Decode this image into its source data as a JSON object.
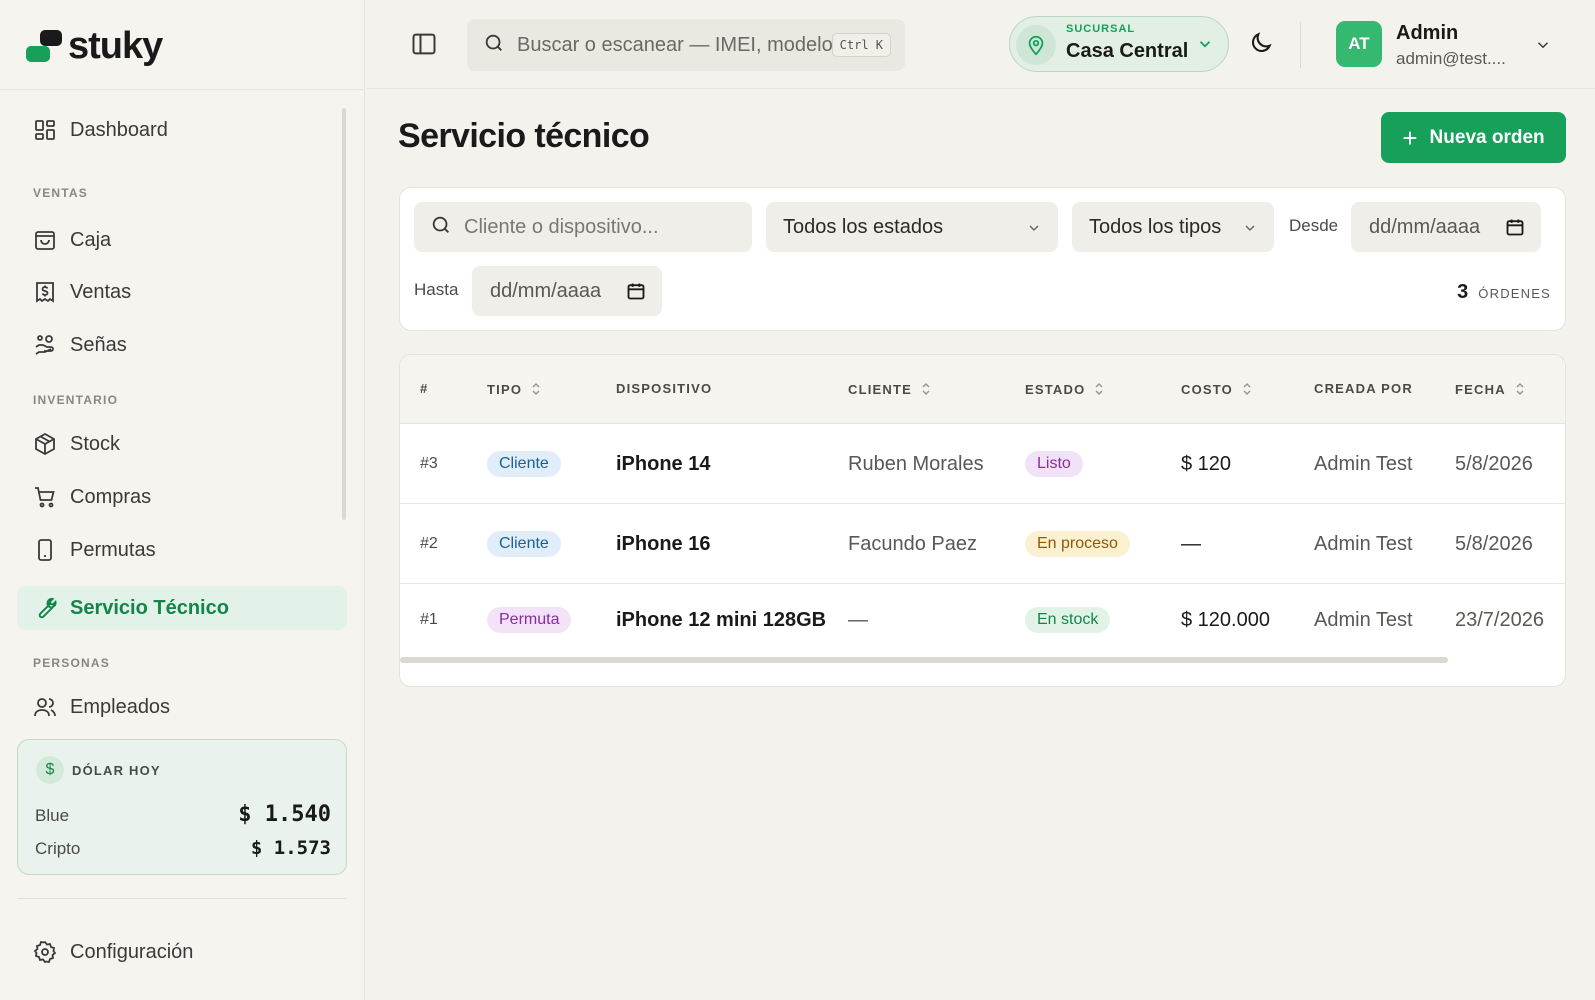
{
  "brand": {
    "name": "stuky"
  },
  "nav": {
    "dashboard": "Dashboard",
    "sections": {
      "ventas": "VENTAS",
      "inventario": "INVENTARIO",
      "personas": "PERSONAS"
    },
    "caja": "Caja",
    "ventas": "Ventas",
    "senas": "Señas",
    "stock": "Stock",
    "compras": "Compras",
    "permutas": "Permutas",
    "servicio": "Servicio Técnico",
    "empleados": "Empleados",
    "config": "Configuración"
  },
  "dolar": {
    "title": "DÓLAR HOY",
    "blue_label": "Blue",
    "blue_value": "$ 1.540",
    "cripto_label": "Cripto",
    "cripto_value": "$ 1.573"
  },
  "topbar": {
    "search_placeholder": "Buscar o escanear — IMEI, modelo, cliente",
    "shortcut": "Ctrl K",
    "branch_caption": "SUCURSAL",
    "branch_name": "Casa Central",
    "user_initials": "AT",
    "user_name": "Admin",
    "user_email": "admin@test...."
  },
  "page": {
    "title": "Servicio técnico",
    "new_order": "Nueva orden"
  },
  "filters": {
    "search_placeholder": "Cliente o dispositivo...",
    "estado": "Todos los estados",
    "tipo": "Todos los tipos",
    "desde_label": "Desde",
    "desde_value": "dd/mm/aaaa",
    "hasta_label": "Hasta",
    "hasta_value": "dd/mm/aaaa",
    "count": "3",
    "count_unit": "ÓRDENES"
  },
  "table": {
    "headers": {
      "num": "#",
      "tipo": "TIPO",
      "dispositivo": "DISPOSITIVO",
      "cliente": "CLIENTE",
      "estado": "ESTADO",
      "costo": "COSTO",
      "creada": "CREADA POR",
      "fecha": "FECHA"
    },
    "rows": [
      {
        "num": "#3",
        "tipo": "Cliente",
        "dispositivo": "iPhone 14",
        "cliente": "Ruben Morales",
        "estado": "Listo",
        "costo": "$ 120",
        "creada": "Admin Test",
        "fecha": "5/8/2026"
      },
      {
        "num": "#2",
        "tipo": "Cliente",
        "dispositivo": "iPhone 16",
        "cliente": "Facundo Paez",
        "estado": "En proceso",
        "costo": "—",
        "creada": "Admin Test",
        "fecha": "5/8/2026"
      },
      {
        "num": "#1",
        "tipo": "Permuta",
        "dispositivo": "iPhone 12 mini 128GB",
        "cliente": "—",
        "estado": "En stock",
        "costo": "$ 120.000",
        "creada": "Admin Test",
        "fecha": "23/7/2026"
      }
    ]
  },
  "colors": {
    "accent": "#16a05a",
    "accent_soft": "#e3f2e8",
    "background": "#f4f2ed"
  }
}
